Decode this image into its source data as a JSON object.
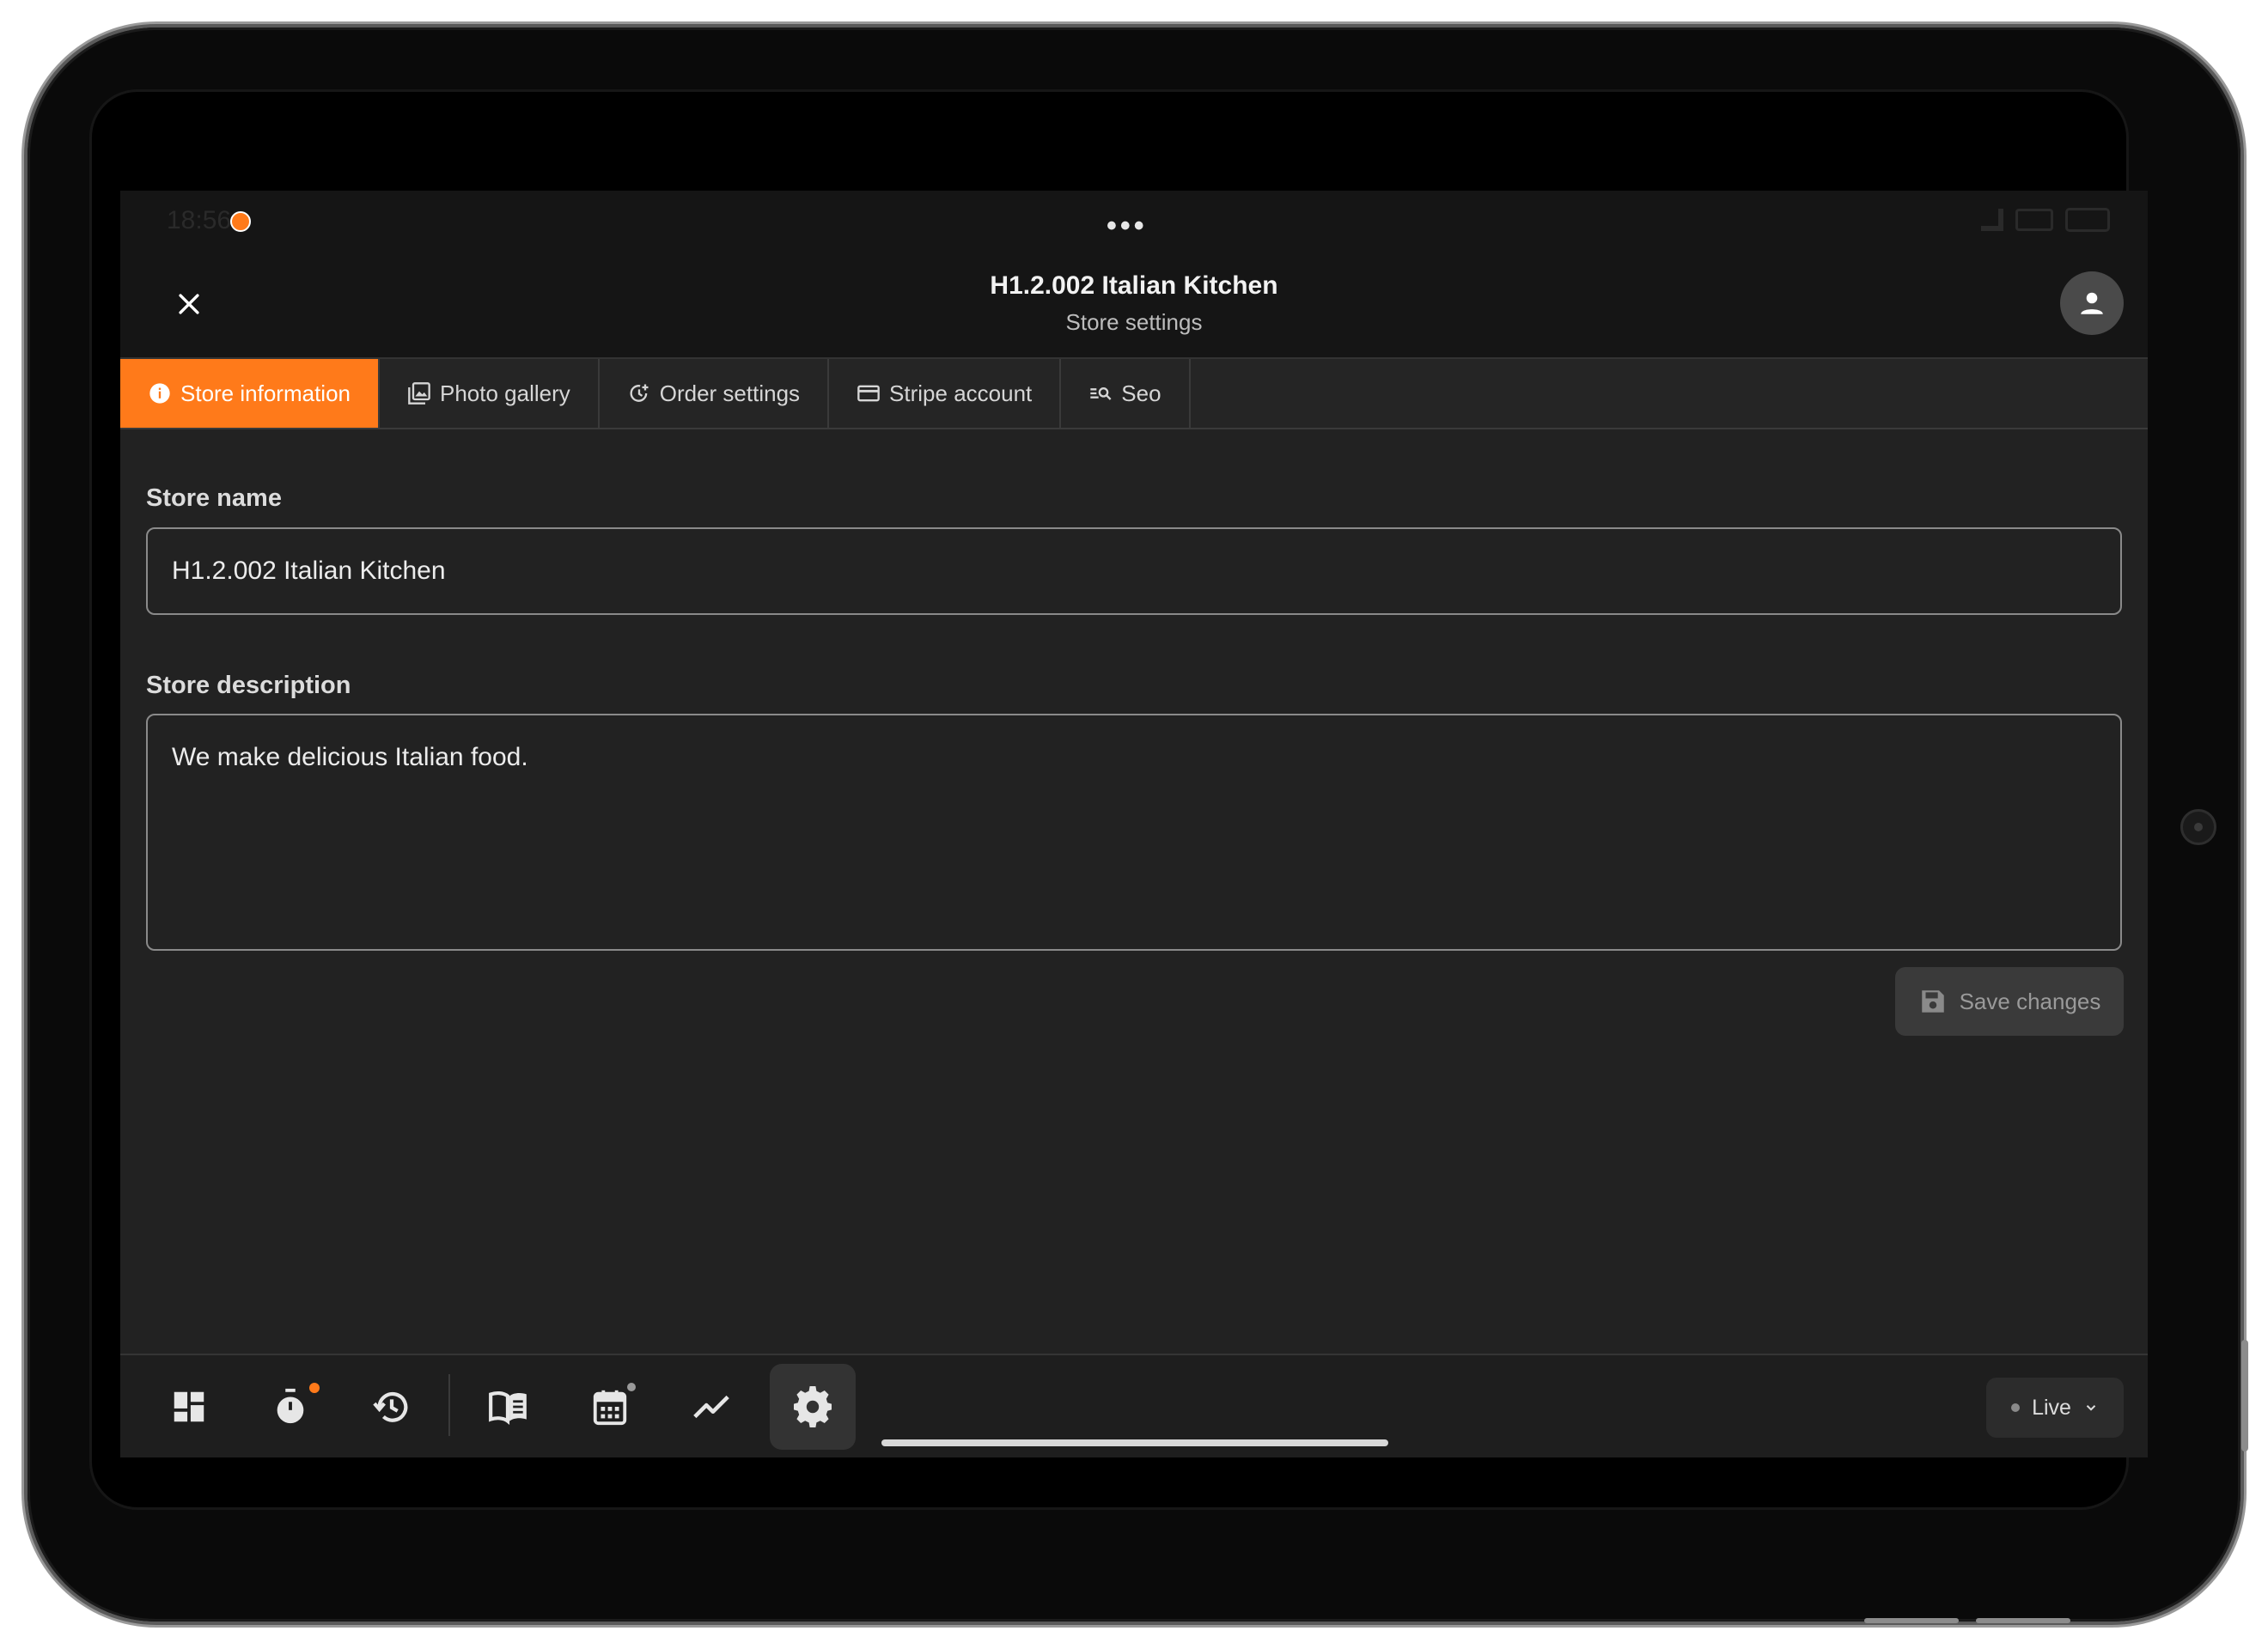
{
  "status_bar": {
    "time": "18:56",
    "handle": "•••"
  },
  "header": {
    "title": "H1.2.002 Italian Kitchen",
    "subtitle": "Store settings"
  },
  "tabs": [
    {
      "label": "Store information",
      "icon": "info-icon",
      "active": true
    },
    {
      "label": "Photo gallery",
      "icon": "photo-library-icon",
      "active": false
    },
    {
      "label": "Order settings",
      "icon": "order-history-icon",
      "active": false
    },
    {
      "label": "Stripe account",
      "icon": "credit-card-icon",
      "active": false
    },
    {
      "label": "Seo",
      "icon": "search-list-icon",
      "active": false
    }
  ],
  "form": {
    "store_name_label": "Store name",
    "store_name_value": "H1.2.002 Italian Kitchen",
    "store_description_label": "Store description",
    "store_description_value": "We make delicious Italian food.",
    "save_label": "Save changes"
  },
  "bottom_nav": {
    "items": [
      {
        "icon": "dashboard-icon"
      },
      {
        "icon": "timer-icon",
        "badge": true
      },
      {
        "icon": "history-icon"
      },
      {
        "icon": "menu-book-icon"
      },
      {
        "icon": "calendar-icon",
        "badge": true
      },
      {
        "icon": "analytics-trend-icon"
      },
      {
        "icon": "settings-gear-icon",
        "active": true
      }
    ],
    "status_label": "Live"
  },
  "colors": {
    "accent": "#ff7a1a",
    "background": "#222222",
    "header": "#151515"
  }
}
